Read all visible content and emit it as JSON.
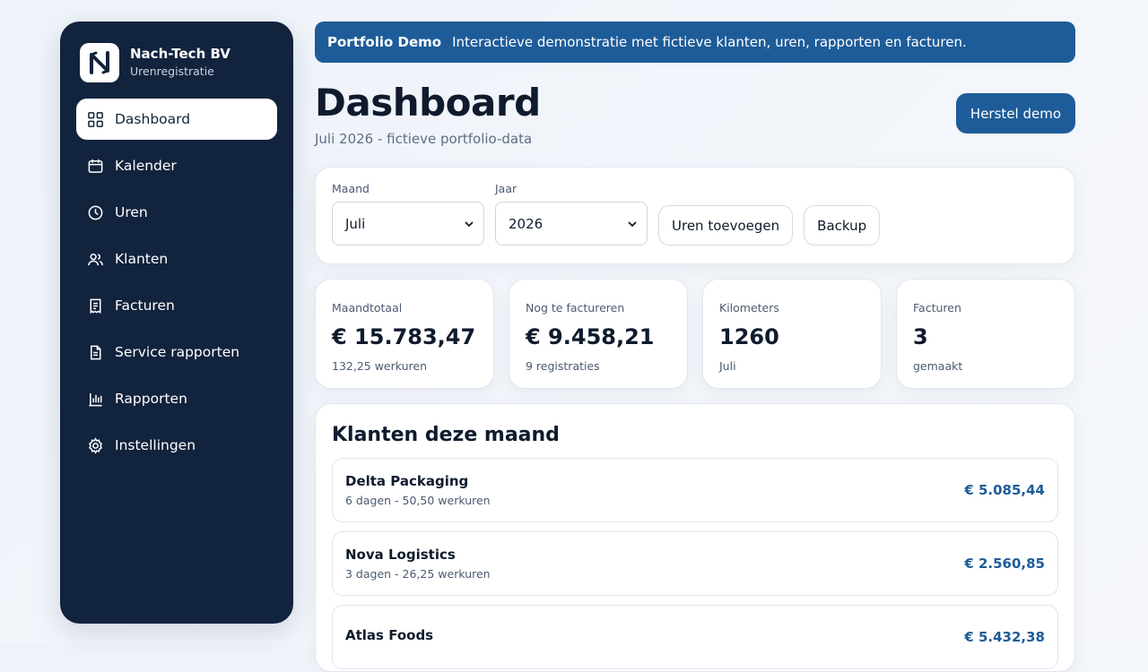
{
  "brand": {
    "name": "Nach-Tech BV",
    "subtitle": "Urenregistratie"
  },
  "nav": [
    {
      "label": "Dashboard",
      "icon": "grid-icon",
      "active": true
    },
    {
      "label": "Kalender",
      "icon": "calendar-icon"
    },
    {
      "label": "Uren",
      "icon": "clock-icon"
    },
    {
      "label": "Klanten",
      "icon": "users-icon"
    },
    {
      "label": "Facturen",
      "icon": "invoice-icon"
    },
    {
      "label": "Service rapporten",
      "icon": "document-icon"
    },
    {
      "label": "Rapporten",
      "icon": "bar-chart-icon"
    },
    {
      "label": "Instellingen",
      "icon": "gear-icon"
    }
  ],
  "banner": {
    "title": "Portfolio Demo",
    "text": "Interactieve demonstratie met fictieve klanten, uren, rapporten en facturen."
  },
  "header": {
    "title": "Dashboard",
    "subtitle": "Juli 2026 - fictieve portfolio-data",
    "reset_label": "Herstel demo"
  },
  "filters": {
    "month_label": "Maand",
    "month_value": "Juli",
    "year_label": "Jaar",
    "year_value": "2026",
    "add_hours_label": "Uren toevoegen",
    "backup_label": "Backup"
  },
  "stats": [
    {
      "label": "Maandtotaal",
      "value": "€ 15.783,47",
      "note": "132,25 werkuren"
    },
    {
      "label": "Nog te factureren",
      "value": "€ 9.458,21",
      "note": "9 registraties"
    },
    {
      "label": "Kilometers",
      "value": "1260",
      "note": "Juli"
    },
    {
      "label": "Facturen",
      "value": "3",
      "note": "gemaakt"
    }
  ],
  "clients": {
    "title": "Klanten deze maand",
    "items": [
      {
        "name": "Delta Packaging",
        "meta": "6 dagen - 50,50 werkuren",
        "amount": "€ 5.085,44"
      },
      {
        "name": "Nova Logistics",
        "meta": "3 dagen - 26,25 werkuren",
        "amount": "€ 2.560,85"
      },
      {
        "name": "Atlas Foods",
        "meta": "",
        "amount": "€ 5.432,38"
      }
    ]
  },
  "colors": {
    "sidebar": "#12233d",
    "accent": "#1e5c99",
    "background": "#eef3fa"
  }
}
